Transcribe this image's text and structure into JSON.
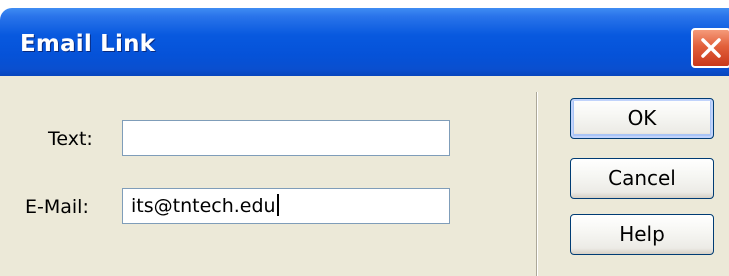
{
  "window": {
    "title": "Email Link",
    "close_icon": "close-icon"
  },
  "form": {
    "text_label": "Text:",
    "text_value": "",
    "email_label": "E-Mail:",
    "email_value": "its@tntech.edu"
  },
  "buttons": {
    "ok": "OK",
    "cancel": "Cancel",
    "help": "Help"
  },
  "colors": {
    "titlebar": "#0859df",
    "dialog_background": "#ece9d8",
    "close_button": "#e2603b",
    "field_border": "#7f9db9",
    "button_border": "#003c74"
  }
}
